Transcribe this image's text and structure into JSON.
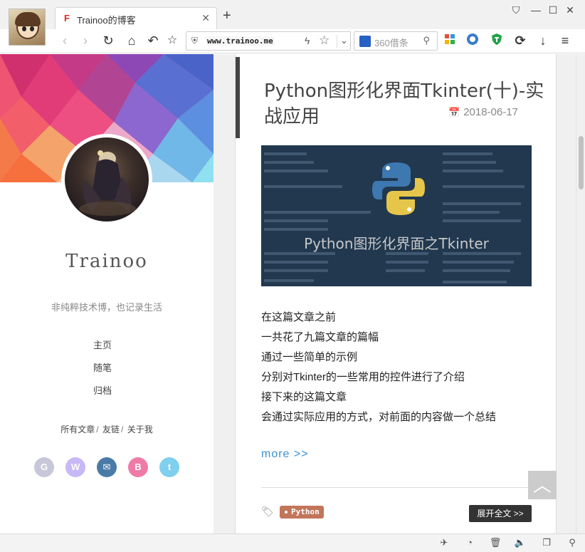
{
  "browser": {
    "tab_title": "Trainoo的博客",
    "tab_favicon": "F",
    "url": "www.trainoo.me",
    "search_placeholder": "360借条",
    "icons": [
      "back-icon",
      "forward-icon",
      "reload-icon",
      "home-icon",
      "undo-icon",
      "bookmark-star-icon",
      "shield-icon",
      "lightning-icon",
      "favorite-star-icon",
      "dropdown-icon",
      "search-icon",
      "apps-grid-icon",
      "security-icon",
      "guard-icon",
      "sync-icon",
      "download-icon",
      "menu-icon"
    ]
  },
  "sidebar": {
    "site_name": "Trainoo",
    "description": "非纯粹技术博，也记录生活",
    "nav": [
      "主页",
      "随笔",
      "归档"
    ],
    "links": [
      "所有文章",
      "友链",
      "关于我"
    ],
    "link_separator": "/",
    "socials": [
      {
        "name": "github",
        "glyph": "G",
        "color": "#c7c7d9"
      },
      {
        "name": "weibo",
        "glyph": "W",
        "color": "#c8b8f5"
      },
      {
        "name": "email",
        "glyph": "✉",
        "color": "#4a7ba7"
      },
      {
        "name": "bilibili",
        "glyph": "B",
        "color": "#f07aa7"
      },
      {
        "name": "twitter",
        "glyph": "t",
        "color": "#7fcfee"
      }
    ]
  },
  "post": {
    "title": "Python图形化界面Tkinter(十)-实战应用",
    "date": "2018-06-17",
    "cover_title": "Python图形化界面之Tkinter",
    "body": [
      "在这篇文章之前",
      "一共花了九篇文章的篇幅",
      "通过一些简单的示例",
      "分别对Tkinter的一些常用的控件进行了介绍",
      "接下来的这篇文章",
      "会通过实际应用的方式，对前面的内容做一个总结"
    ],
    "more": "more >>",
    "tag": "Python",
    "expand": "展开全文 >>"
  },
  "colors": {
    "accent_link": "#3a8fd0",
    "tag_bg": "#c2755a",
    "cover_bg": "#21384f"
  }
}
